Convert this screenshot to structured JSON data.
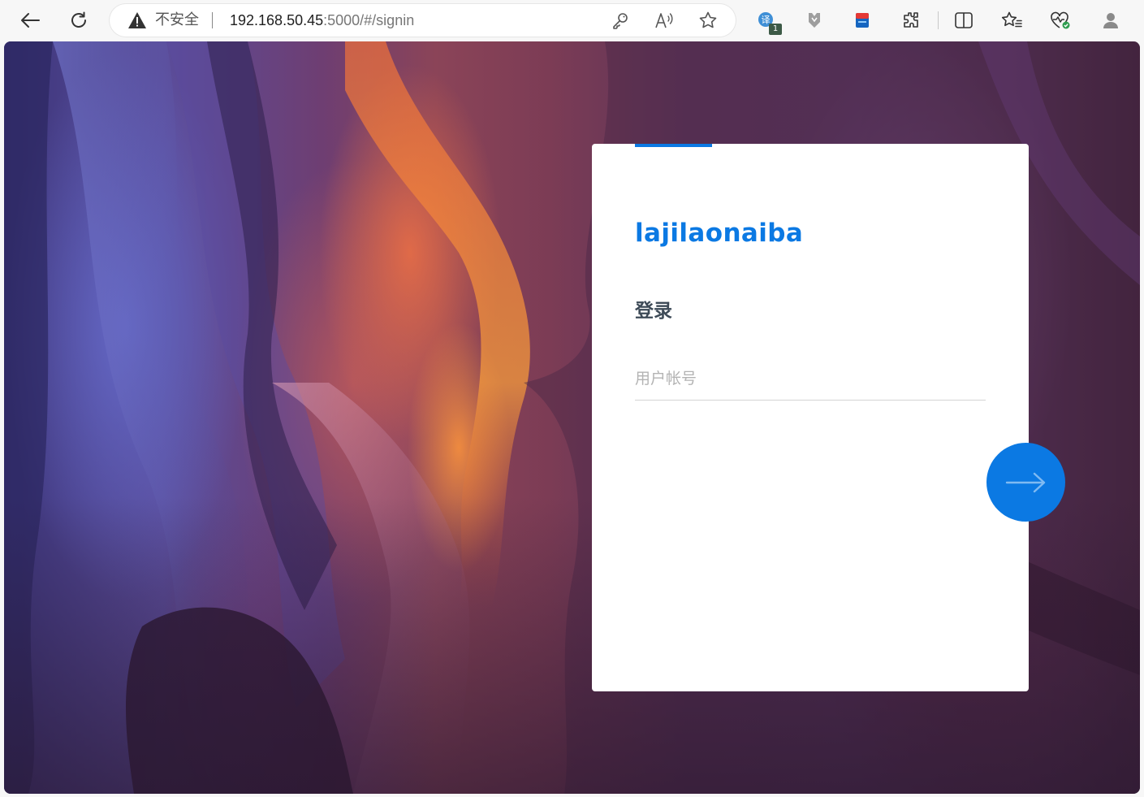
{
  "browser": {
    "security_label": "不安全",
    "url_host": "192.168.50.45",
    "url_path": ":5000/#/signin",
    "extension_badge_count": "1",
    "icons": {
      "back": "back-arrow-icon",
      "refresh": "refresh-icon",
      "warning": "warning-icon",
      "password": "key-icon",
      "read_aloud": "read-aloud-icon",
      "favorite": "star-icon",
      "extension_1": "translate-extension-icon",
      "extension_2": "shield-extension-icon",
      "extension_3": "blue-extension-icon",
      "extensions": "puzzle-icon",
      "split_screen": "split-screen-icon",
      "favorites": "favorites-icon",
      "performance": "heart-pulse-icon",
      "profile": "profile-icon"
    }
  },
  "login": {
    "brand": "lajilaonaiba",
    "title": "登录",
    "username_placeholder": "用户帐号",
    "username_value": "",
    "submit_icon": "arrow-right-icon"
  },
  "colors": {
    "accent": "#0b79e3",
    "title": "#3d4a57",
    "placeholder": "#b3b3b3"
  }
}
